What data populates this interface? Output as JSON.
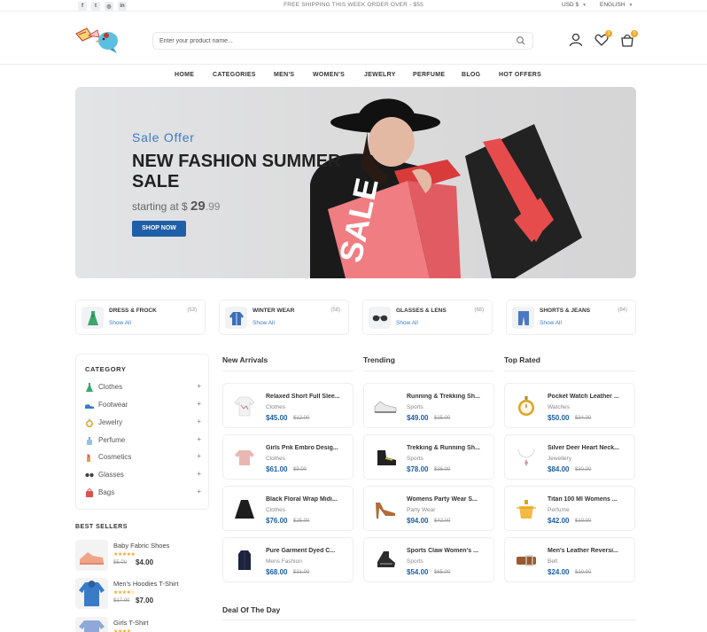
{
  "topbar": {
    "social": [
      {
        "name": "facebook-icon",
        "glyph": "f"
      },
      {
        "name": "twitter-icon",
        "glyph": "t"
      },
      {
        "name": "instagram-icon",
        "glyph": "◎"
      },
      {
        "name": "linkedin-icon",
        "glyph": "in"
      }
    ],
    "shipping": "FREE SHIPPING THIS WEEK ORDER OVER - $55",
    "currency": "USD $",
    "language": "ENGLISH"
  },
  "header": {
    "search_placeholder": "Enter your product name...",
    "wishlist_count": "0",
    "cart_count": "0"
  },
  "nav": [
    "HOME",
    "CATEGORIES",
    "MEN'S",
    "WOMEN'S",
    "JEWELRY",
    "PERFUME",
    "BLOG",
    "HOT OFFERS"
  ],
  "hero": {
    "subtitle": "Sale Offer",
    "title": "NEW FASHION SUMMER SALE",
    "price_prefix": "starting at $",
    "price_main": "29",
    "price_cents": ".99",
    "button": "SHOP NOW",
    "bag_text": "SALE"
  },
  "categories": [
    {
      "name": "DRESS & FROCK",
      "count": "(53)",
      "link": "Show All",
      "icon": "dress-icon"
    },
    {
      "name": "WINTER WEAR",
      "count": "(58)",
      "link": "Show All",
      "icon": "coat-icon"
    },
    {
      "name": "GLASSES & LENS",
      "count": "(68)",
      "link": "Show All",
      "icon": "glasses-icon"
    },
    {
      "name": "SHORTS & JEANS",
      "count": "(84)",
      "link": "Show All",
      "icon": "jeans-icon"
    }
  ],
  "sidebar": {
    "title": "CATEGORY",
    "items": [
      {
        "label": "Clothes",
        "plus": "+",
        "color": "#3aa76d"
      },
      {
        "label": "Footwear",
        "plus": "+",
        "color": "#3a7bc8"
      },
      {
        "label": "Jewelry",
        "plus": "+",
        "color": "#d4a017"
      },
      {
        "label": "Perfume",
        "plus": "+",
        "color": "#8bc6e8"
      },
      {
        "label": "Cosmetics",
        "plus": "+",
        "color": "#e05a4f"
      },
      {
        "label": "Glasses",
        "plus": "+",
        "color": "#444444"
      },
      {
        "label": "Bags",
        "plus": "+",
        "color": "#d9534f"
      }
    ]
  },
  "best_sellers": {
    "title": "BEST SELLERS",
    "items": [
      {
        "name": "Baby Fabric Shoes",
        "stars": "★★★★★",
        "old": "$5.00",
        "price": "$4.00"
      },
      {
        "name": "Men's Hoodies T-Shirt",
        "stars": "★★★★☆",
        "old": "$17.00",
        "price": "$7.00"
      },
      {
        "name": "Girls T-Shirt",
        "stars": "★★★★",
        "old": "",
        "price": ""
      }
    ]
  },
  "columns": [
    {
      "title": "New Arrivals",
      "products": [
        {
          "name": "Relaxed Short Full Slee...",
          "cat": "Clothes",
          "price": "$45.00",
          "old": "$12.00",
          "icon": "shirt-icon"
        },
        {
          "name": "Girls Pnk Embro Desig...",
          "cat": "Clothes",
          "price": "$61.00",
          "old": "$9.00",
          "icon": "top-icon"
        },
        {
          "name": "Black Floral Wrap Midi...",
          "cat": "Clothes",
          "price": "$76.00",
          "old": "$25.00",
          "icon": "skirt-icon"
        },
        {
          "name": "Pure Garment Dyed C...",
          "cat": "Mens Fashion",
          "price": "$68.00",
          "old": "$31.00",
          "icon": "jacket-icon"
        }
      ]
    },
    {
      "title": "Trending",
      "products": [
        {
          "name": "Running & Trekking Sh...",
          "cat": "Sports",
          "price": "$49.00",
          "old": "$15.00",
          "icon": "sneaker-icon"
        },
        {
          "name": "Trekking & Running Sh...",
          "cat": "Sports",
          "price": "$78.00",
          "old": "$36.00",
          "icon": "boot-icon"
        },
        {
          "name": "Womens Party Wear S...",
          "cat": "Party Wear",
          "price": "$94.00",
          "old": "$42.00",
          "icon": "heel-icon"
        },
        {
          "name": "Sports Claw Women's ...",
          "cat": "Sports",
          "price": "$54.00",
          "old": "$65.00",
          "icon": "sport-shoe-icon"
        }
      ]
    },
    {
      "title": "Top Rated",
      "products": [
        {
          "name": "Pocket Watch Leather ...",
          "cat": "Watches",
          "price": "$50.00",
          "old": "$34.00",
          "icon": "watch-icon"
        },
        {
          "name": "Silver Deer Heart Neck...",
          "cat": "Jewellery",
          "price": "$84.00",
          "old": "$30.00",
          "icon": "necklace-icon"
        },
        {
          "name": "Titan 100 Ml Womens ...",
          "cat": "Perfume",
          "price": "$42.00",
          "old": "$10.00",
          "icon": "perfume-icon"
        },
        {
          "name": "Men's Leather Reversi...",
          "cat": "Belt",
          "price": "$24.00",
          "old": "$10.00",
          "icon": "belt-icon"
        }
      ]
    }
  ],
  "deal_title": "Deal Of The Day"
}
